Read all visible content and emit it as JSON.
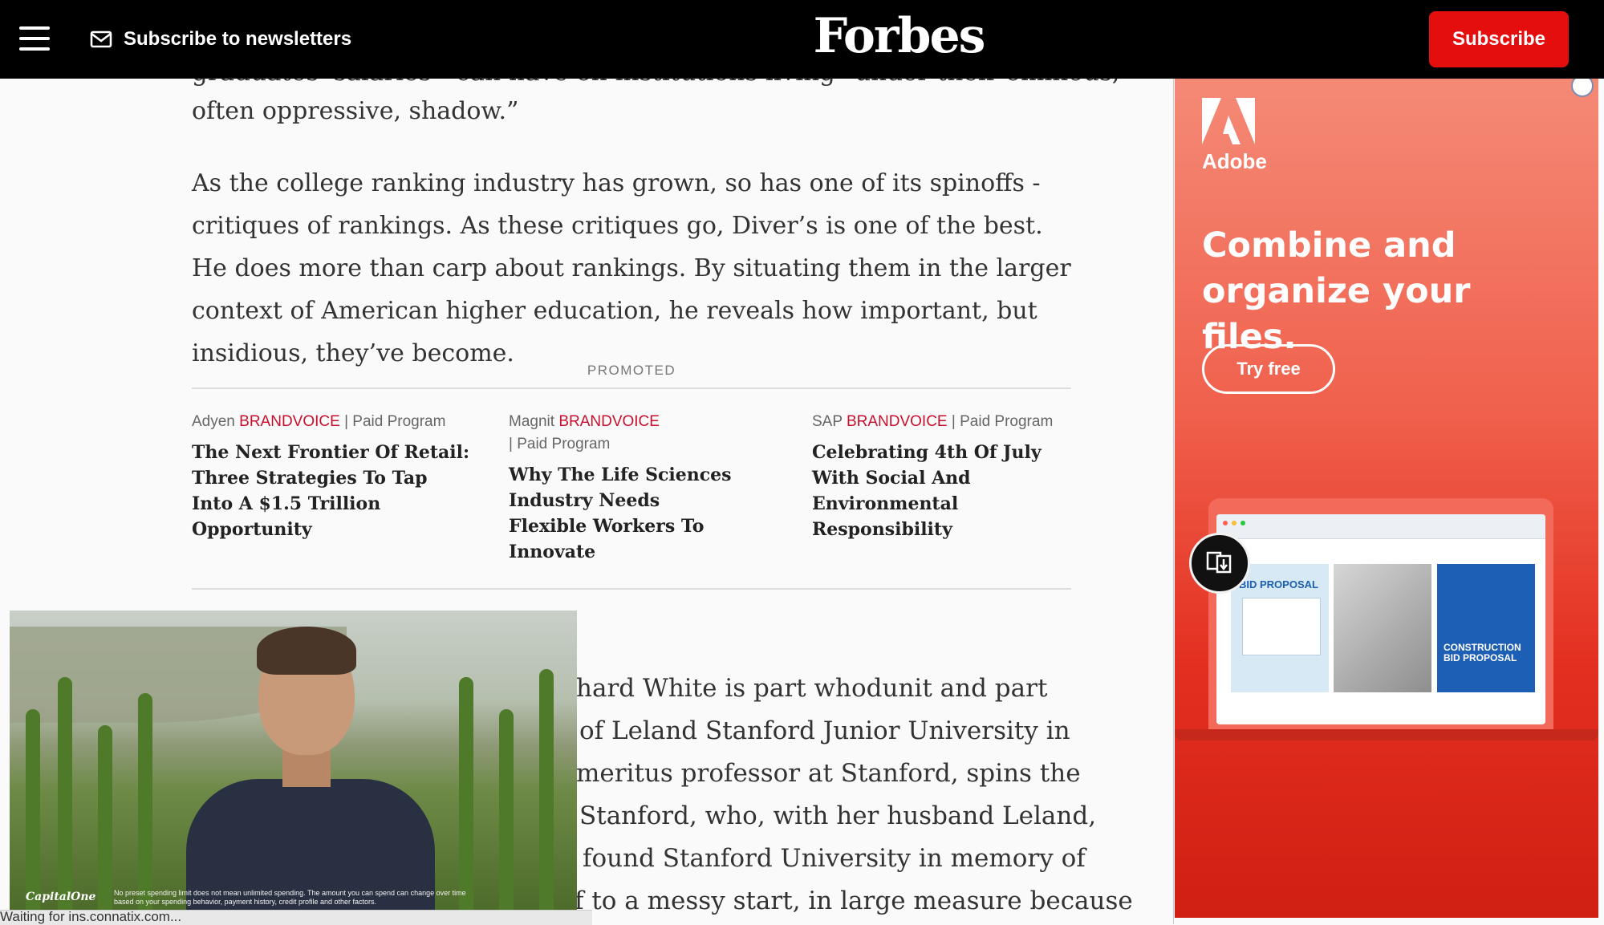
{
  "header": {
    "menu_icon": "hamburger-menu-icon",
    "newsletter_label": "Subscribe to newsletters",
    "newsletter_icon": "envelope-icon",
    "logo": "Forbes",
    "subscribe_label": "Subscribe"
  },
  "article": {
    "cut_off_line": "graduates' salaries—can have on institutions living \"under their ominous,",
    "paragraph_1": "often oppressive, shadow.”",
    "paragraph_2": "As the college ranking industry has grown, so has one of its spinoffs - critiques of rankings. As these critiques go, Diver’s is one of the best. He does more than carp about rankings. By situating them in the larger context of American higher education, he reveals how important, but insidious, they’ve become.",
    "lower_lines": [
      "hard White is part whodunit and part",
      "of Leland Stanford Junior University in",
      "meritus professor at Stanford, spins the",
      "Stanford, who, with her husband Leland,",
      "found Stanford University in memory of",
      "f to a messy start, in large measure because"
    ]
  },
  "promoted": {
    "label": "PROMOTED",
    "cards": [
      {
        "sponsor": "Adyen",
        "brand": "BRANDVOICE",
        "program": "| Paid Program",
        "title": "The Next Frontier Of Retail: Three Strategies To Tap Into A $1.5 Trillion Opportunity"
      },
      {
        "sponsor": "Magnit",
        "brand": "BRANDVOICE",
        "program": "| Paid Program",
        "title": "Why The Life Sciences Industry Needs Flexible Workers To Innovate"
      },
      {
        "sponsor": "SAP",
        "brand": "BRANDVOICE",
        "program": "| Paid Program",
        "title": "Celebrating 4th Of July With Social And Environmental Responsibility"
      }
    ]
  },
  "video": {
    "brand": "CapitalOne",
    "disclaimer": "No preset spending limit does not mean unlimited spending. The amount you can spend can change over time based on your spending behavior, payment history, credit profile and other factors."
  },
  "status_bar": "Waiting for ins.connatix.com...",
  "ad": {
    "brand": "Adobe",
    "headline": "Combine and organize your files.",
    "cta": "Try free",
    "panel_1_title": "BID PROPOSAL",
    "panel_3_title": "CONSTRUCTION BID PROPOSAL",
    "download_icon": "file-download-icon",
    "colors": {
      "accent": "#e50e0e",
      "ad_red": "#e32f20"
    }
  }
}
